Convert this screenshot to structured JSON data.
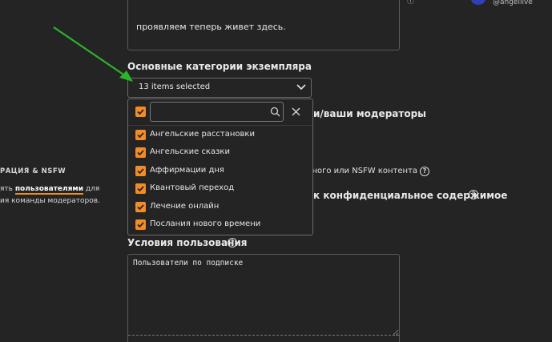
{
  "header": {
    "username": "@angellive"
  },
  "description": {
    "tail_text": "проявляем теперь живет здесь."
  },
  "instance_categories": {
    "heading": "Основные категории экземпляра",
    "selected_summary": "13 items selected",
    "search_value": "",
    "options": [
      {
        "label": "Ангельские расстановки",
        "checked": true
      },
      {
        "label": "Ангельские сказки",
        "checked": true
      },
      {
        "label": "Аффирмации дня",
        "checked": true
      },
      {
        "label": "Квантовый переход",
        "checked": true
      },
      {
        "label": "Лечение онлайн",
        "checked": true
      },
      {
        "label": "Послания нового времени",
        "checked": true
      }
    ]
  },
  "behind_dropdown": {
    "moderators_partial": "и/ваши модераторы",
    "nsfw_partial": "ельного или NSFW контента",
    "private_partial": "к конфиденциальное содержимое"
  },
  "sidebar": {
    "heading_partial": "РАЦИЯ & NSFW",
    "line1_before": "ять ",
    "line1_link": "пользователями",
    "line1_after": " для",
    "line2": "ия команды модераторов."
  },
  "terms": {
    "heading": "Условия пользования",
    "value": "Пользователи по подписке"
  },
  "colors": {
    "accent": "#f28c28",
    "background": "#242424",
    "arrow": "#2bb52b"
  },
  "icons": {
    "help": "?",
    "clear": "✕"
  }
}
